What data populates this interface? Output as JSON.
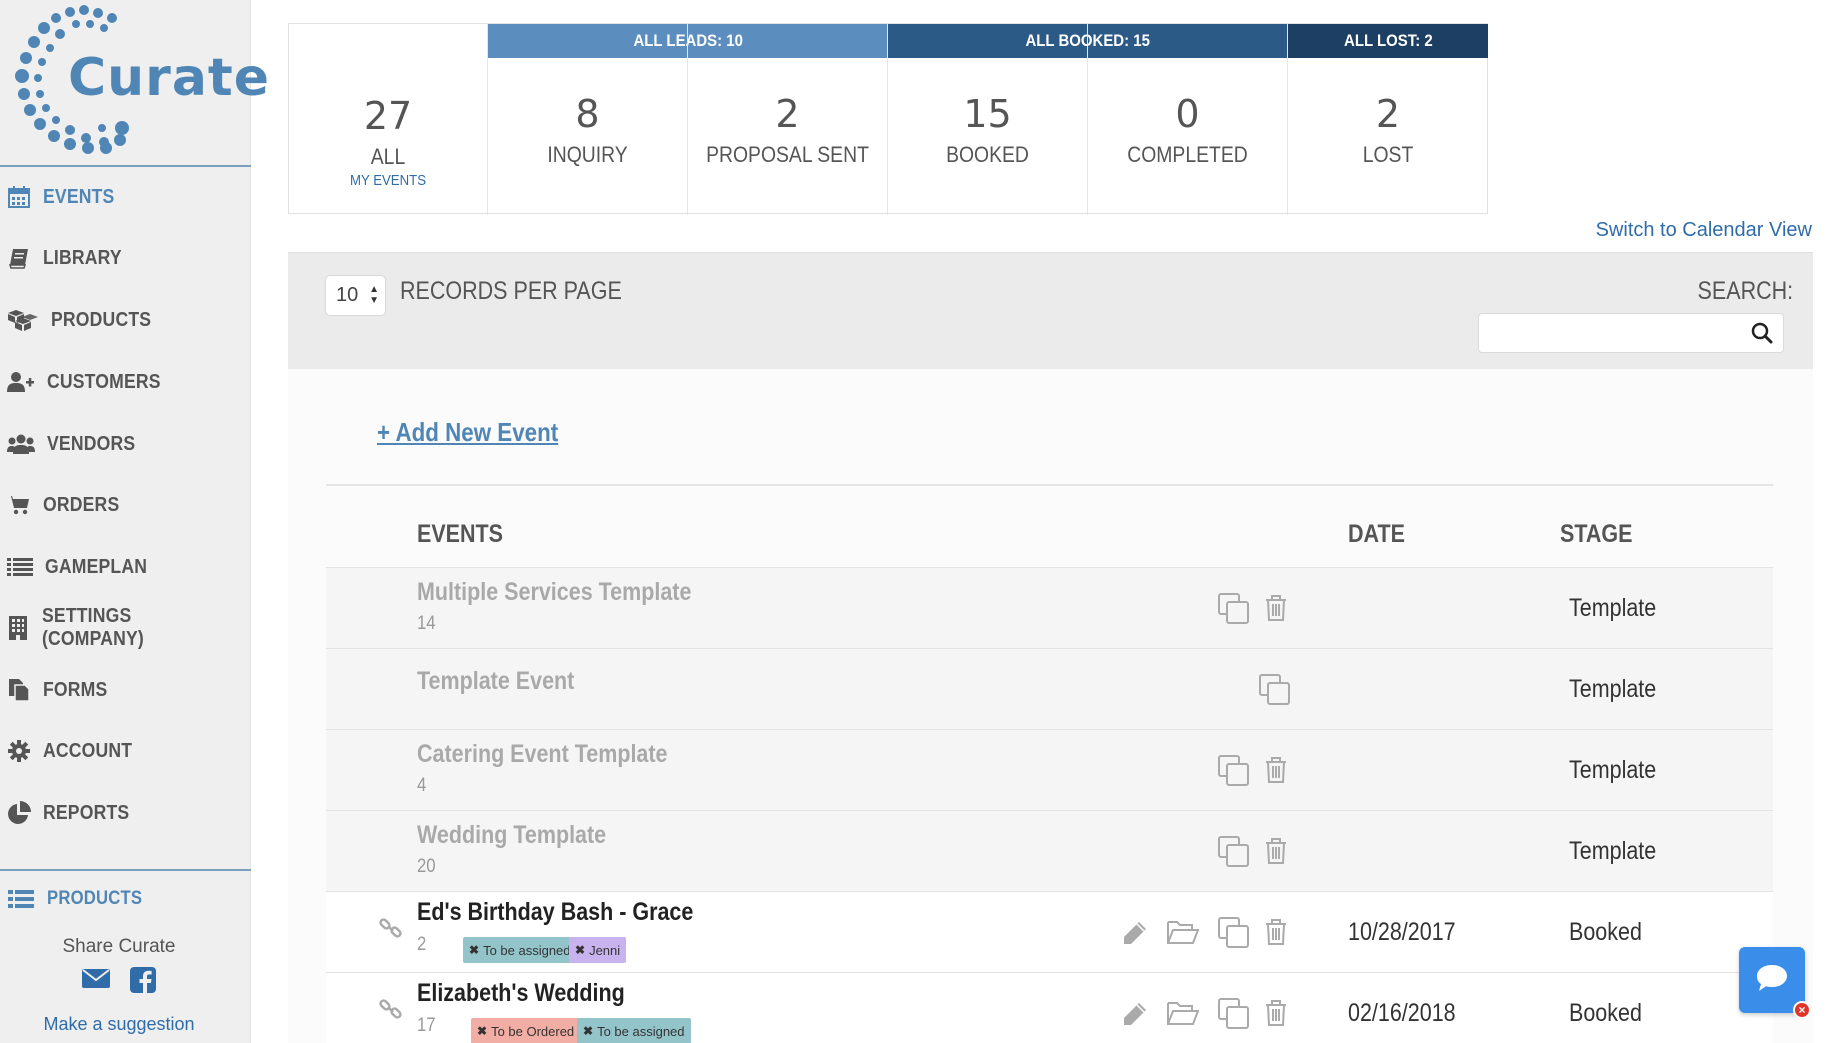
{
  "brand": {
    "name": "Curate",
    "accent": "#4f86b5"
  },
  "sidebar": {
    "items": [
      {
        "label": "EVENTS",
        "icon": "calendar-icon",
        "active": true
      },
      {
        "label": "LIBRARY",
        "icon": "book-icon"
      },
      {
        "label": "PRODUCTS",
        "icon": "cubes-icon"
      },
      {
        "label": "CUSTOMERS",
        "icon": "user-plus-icon"
      },
      {
        "label": "VENDORS",
        "icon": "users-icon"
      },
      {
        "label": "ORDERS",
        "icon": "cart-icon"
      },
      {
        "label": "GAMEPLAN",
        "icon": "list-icon"
      },
      {
        "label": "SETTINGS (COMPANY)",
        "icon": "building-icon"
      },
      {
        "label": "FORMS",
        "icon": "files-icon"
      },
      {
        "label": "ACCOUNT",
        "icon": "gear-icon"
      },
      {
        "label": "REPORTS",
        "icon": "pie-chart-icon"
      }
    ],
    "secondary": {
      "label": "PRODUCTS",
      "icon": "list-icon"
    },
    "share_label": "Share Curate",
    "share_icons": [
      "envelope-icon",
      "facebook-icon"
    ],
    "suggestion": "Make a suggestion"
  },
  "stats": {
    "bands": [
      {
        "label": "ALL LEADS: 10",
        "color": "#5b8ebf"
      },
      {
        "label": "ALL BOOKED: 15",
        "color": "#2c5a86"
      },
      {
        "label": "ALL LOST: 2",
        "color": "#1c3f63"
      }
    ],
    "cells": [
      {
        "count": "27",
        "label": "ALL",
        "sublabel": "MY EVENTS"
      },
      {
        "count": "8",
        "label": "INQUIRY"
      },
      {
        "count": "2",
        "label": "PROPOSAL SENT"
      },
      {
        "count": "15",
        "label": "BOOKED"
      },
      {
        "count": "0",
        "label": "COMPLETED"
      },
      {
        "count": "2",
        "label": "LOST"
      }
    ]
  },
  "calendar_link": "Switch to Calendar View",
  "records": {
    "per_page": "10",
    "per_page_label": "RECORDS PER PAGE",
    "search_label": "SEARCH:",
    "search_placeholder": ""
  },
  "add_event": "+ Add New Event",
  "table": {
    "headers": {
      "events": "EVENTS",
      "date": "DATE",
      "stage": "STAGE"
    },
    "rows": [
      {
        "name": "Multiple Services Template",
        "count": "14",
        "date": "",
        "stage": "Template",
        "kind": "template",
        "actions": [
          "copy-icon",
          "trash-icon"
        ],
        "tags": []
      },
      {
        "name": "Template Event",
        "count": "",
        "date": "",
        "stage": "Template",
        "kind": "template",
        "actions": [
          "copy-icon"
        ],
        "tags": []
      },
      {
        "name": "Catering Event Template",
        "count": "4",
        "date": "",
        "stage": "Template",
        "kind": "template",
        "actions": [
          "copy-icon",
          "trash-icon"
        ],
        "tags": []
      },
      {
        "name": "Wedding Template",
        "count": "20",
        "date": "",
        "stage": "Template",
        "kind": "template",
        "actions": [
          "copy-icon",
          "trash-icon"
        ],
        "tags": []
      },
      {
        "name": "Ed's Birthday Bash - Grace",
        "count": "2",
        "date": "10/28/2017",
        "stage": "Booked",
        "kind": "booked",
        "actions": [
          "pencil-icon",
          "folder-open-icon",
          "copy-icon",
          "trash-icon"
        ],
        "tags": [
          {
            "text": "To be assigned",
            "color": "#93c4ca"
          },
          {
            "text": "Jenni",
            "color": "#c9b3ee"
          }
        ]
      },
      {
        "name": "Elizabeth's Wedding",
        "count": "17",
        "date": "02/16/2018",
        "stage": "Booked",
        "kind": "booked",
        "actions": [
          "pencil-icon",
          "folder-open-icon",
          "copy-icon",
          "trash-icon"
        ],
        "tags": [
          {
            "text": "To be Ordered",
            "color": "#f2aea4"
          },
          {
            "text": "To be assigned",
            "color": "#93c4ca"
          }
        ]
      }
    ]
  },
  "chat": {
    "icon": "chat-bubble-icon",
    "close_icon": "close-icon"
  }
}
